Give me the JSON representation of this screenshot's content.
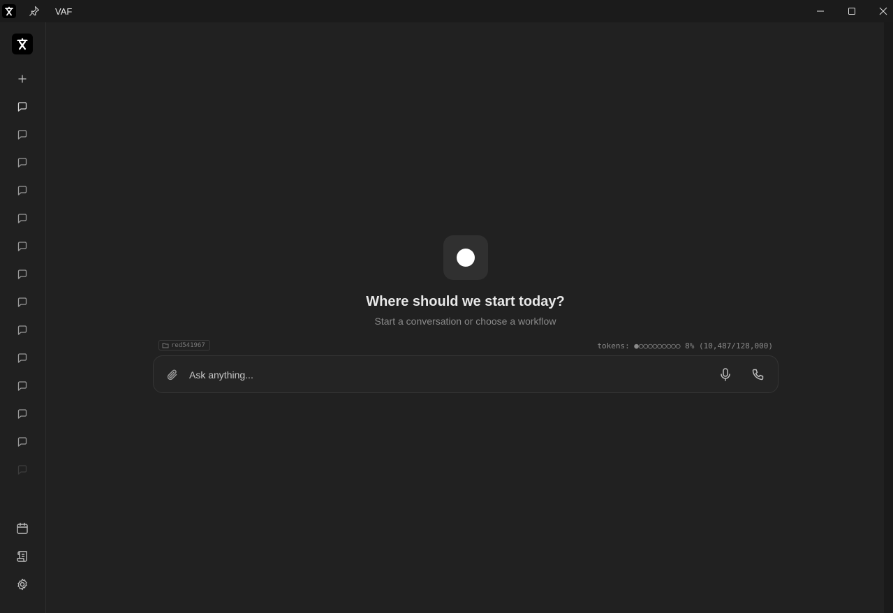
{
  "window": {
    "title": "VAF"
  },
  "sidebar": {
    "conversation_count": 14
  },
  "main": {
    "headline": "Where should we start today?",
    "subline": "Start a conversation or choose a workflow",
    "folder": "red541967",
    "tokens": "tokens: ●○○○○○○○○○ 8% (10,487/128,000)",
    "token_usage_percent": 8,
    "input_placeholder": "Ask anything..."
  },
  "colors": {
    "background": "#212121",
    "sidebar": "#202020",
    "titlebar": "#1b1b1b",
    "hero_icon_bg": "#303030",
    "input_border": "#353535"
  },
  "icons": [
    "app-logo-icon",
    "pin-icon",
    "minimize-icon",
    "maximize-icon",
    "close-icon",
    "plus-icon",
    "chat-icon",
    "calendar-icon",
    "scroll-icon",
    "gear-icon",
    "folder-icon",
    "paperclip-icon",
    "microphone-icon",
    "phone-icon"
  ]
}
